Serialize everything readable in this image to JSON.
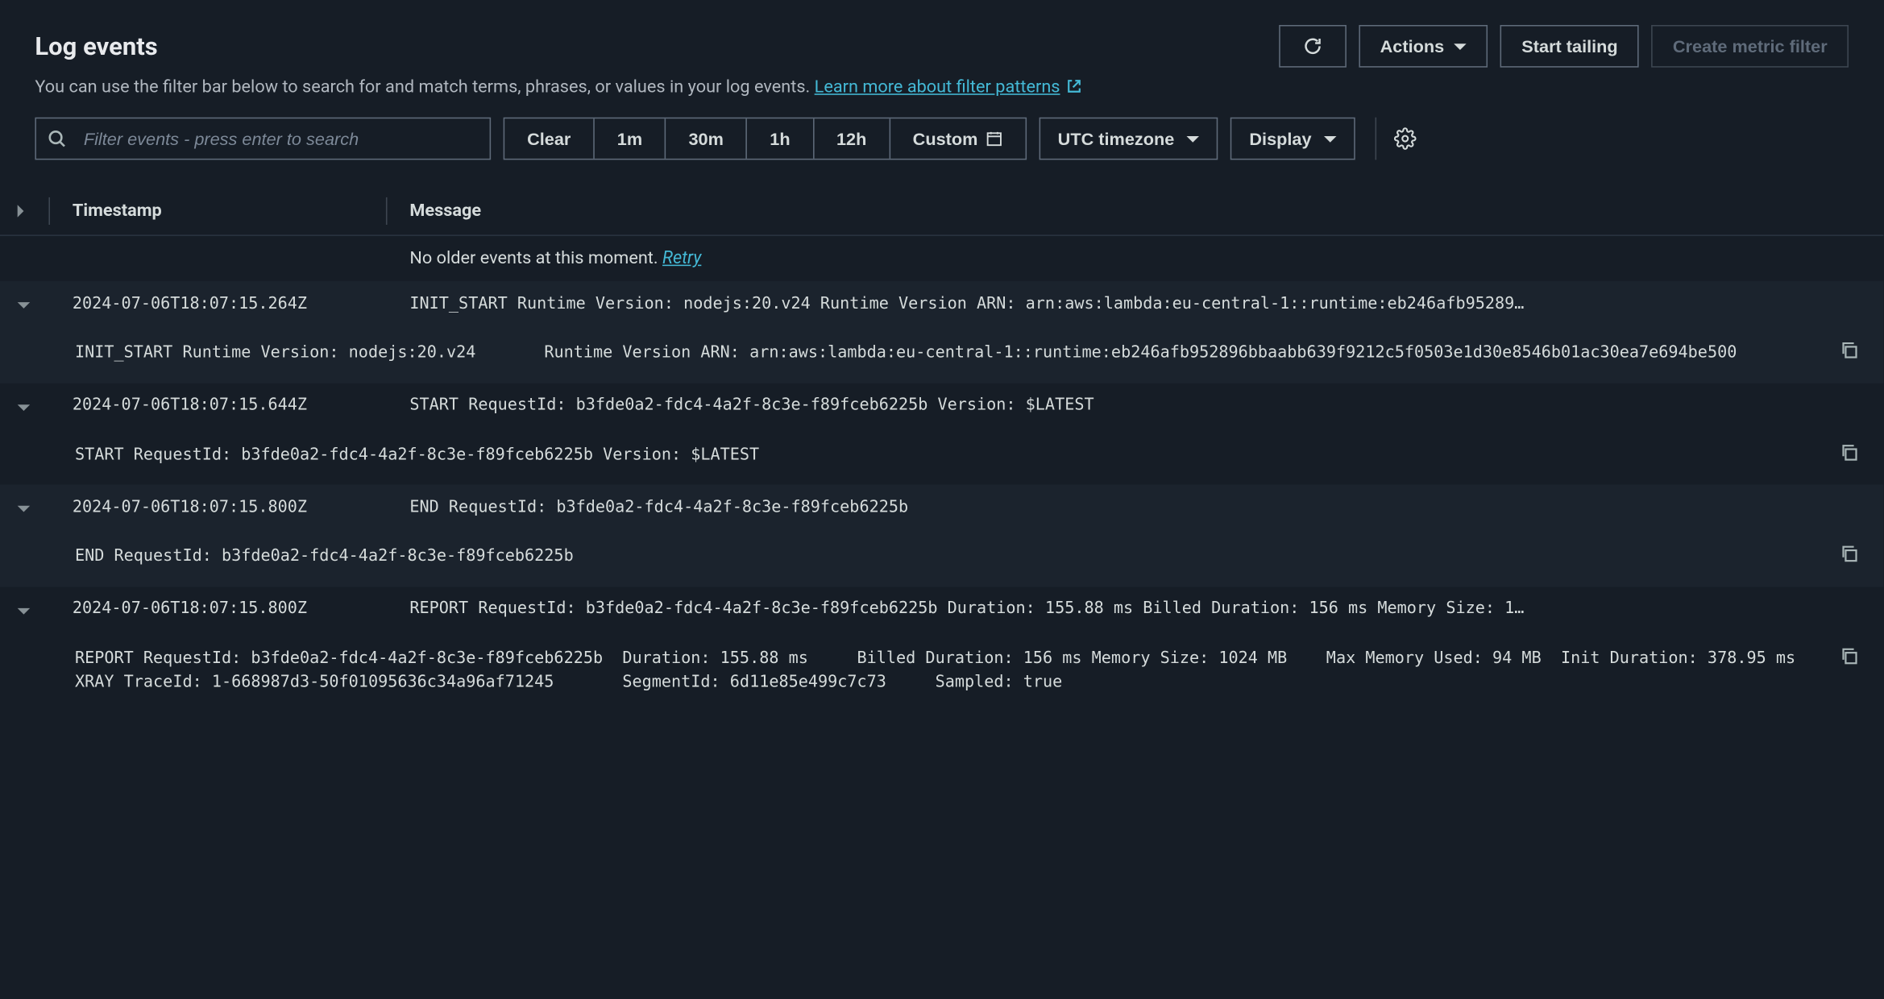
{
  "header": {
    "title": "Log events",
    "description": "You can use the filter bar below to search for and match terms, phrases, or values in your log events. ",
    "learn_more": "Learn more about filter patterns"
  },
  "buttons": {
    "actions": "Actions",
    "start_tailing": "Start tailing",
    "create_metric_filter": "Create metric filter"
  },
  "search": {
    "placeholder": "Filter events - press enter to search"
  },
  "time_filters": {
    "clear": "Clear",
    "m1": "1m",
    "m30": "30m",
    "h1": "1h",
    "h12": "12h",
    "custom": "Custom"
  },
  "timezone": "UTC timezone",
  "display": "Display",
  "table": {
    "col_timestamp": "Timestamp",
    "col_message": "Message",
    "no_older": "No older events at this moment. ",
    "retry": "Retry"
  },
  "events": [
    {
      "timestamp": "2024-07-06T18:07:15.264Z",
      "message": "INIT_START Runtime Version: nodejs:20.v24 Runtime Version ARN: arn:aws:lambda:eu-central-1::runtime:eb246afb95289…",
      "detail": "INIT_START Runtime Version: nodejs:20.v24\tRuntime Version ARN: arn:aws:lambda:eu-central-1::runtime:eb246afb952896bbaabb639f9212c5f0503e1d30e8546b01ac30ea7e694be500"
    },
    {
      "timestamp": "2024-07-06T18:07:15.644Z",
      "message": "START RequestId: b3fde0a2-fdc4-4a2f-8c3e-f89fceb6225b Version: $LATEST",
      "detail": "START RequestId: b3fde0a2-fdc4-4a2f-8c3e-f89fceb6225b Version: $LATEST"
    },
    {
      "timestamp": "2024-07-06T18:07:15.800Z",
      "message": "END RequestId: b3fde0a2-fdc4-4a2f-8c3e-f89fceb6225b",
      "detail": "END RequestId: b3fde0a2-fdc4-4a2f-8c3e-f89fceb6225b"
    },
    {
      "timestamp": "2024-07-06T18:07:15.800Z",
      "message": "REPORT RequestId: b3fde0a2-fdc4-4a2f-8c3e-f89fceb6225b Duration: 155.88 ms Billed Duration: 156 ms Memory Size: 1…",
      "detail": "REPORT RequestId: b3fde0a2-fdc4-4a2f-8c3e-f89fceb6225b\tDuration: 155.88 ms\tBilled Duration: 156 ms Memory Size: 1024 MB\tMax Memory Used: 94 MB\tInit Duration: 378.95 ms\nXRAY TraceId: 1-668987d3-50f01095636c34a96af71245\tSegmentId: 6d11e85e499c7c73\tSampled: true"
    }
  ]
}
